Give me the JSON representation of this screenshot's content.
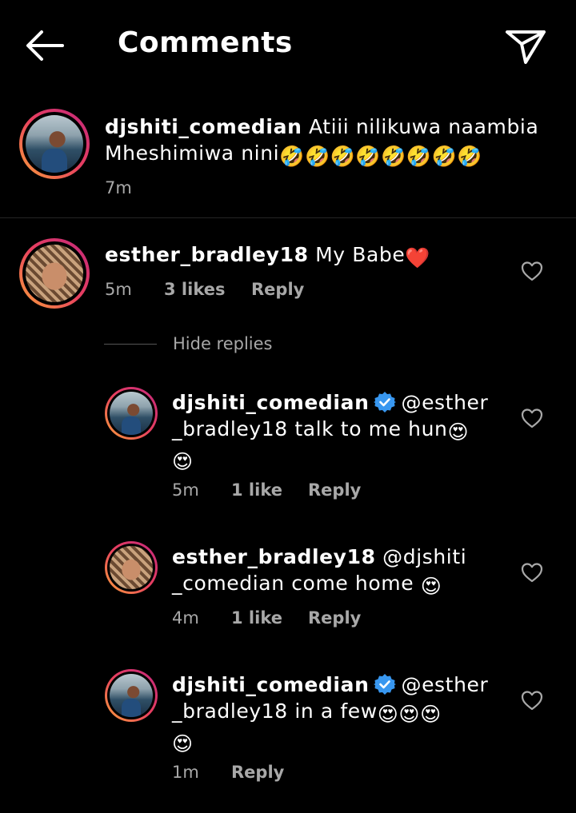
{
  "header": {
    "title": "Comments",
    "back_icon": "arrow-left-icon",
    "send_icon": "paper-plane-icon"
  },
  "caption": {
    "username": "djshiti_comedian",
    "text_line1": "Atiii nilikuwa naambia",
    "text_line2": "Mheshimiwa nini",
    "emojis": "🤣🤣🤣🤣🤣🤣🤣🤣",
    "time": "7m"
  },
  "comment": {
    "username": "esther_bradley18",
    "text": "My Babe",
    "emoji": "❤️",
    "time": "5m",
    "likes": "3 likes",
    "reply": "Reply"
  },
  "hide_replies": "Hide replies",
  "replies": [
    {
      "username": "djshiti_comedian",
      "verified": true,
      "line1_rest": "@esther",
      "line2": "_bradley18 talk to me hun",
      "line2_emoji": "😍",
      "line3_emoji": "😍",
      "time": "5m",
      "likes": "1 like",
      "reply": "Reply"
    },
    {
      "username": "esther_bradley18",
      "verified": false,
      "line1_rest": "@djshiti",
      "line2": "_comedian come home",
      "line2_emoji": "😍",
      "time": "4m",
      "likes": "1 like",
      "reply": "Reply"
    },
    {
      "username": "djshiti_comedian",
      "verified": true,
      "line1_rest": "@esther",
      "line2": "_bradley18 in a few",
      "line2_emoji": "😍😍😍",
      "line3_emoji": "😍",
      "time": "1m",
      "reply": "Reply"
    }
  ],
  "colors": {
    "background": "#000000",
    "text": "#ffffff",
    "meta": "#a8a8a8",
    "verified": "#3897f0",
    "heart_emoji": "#e0245e"
  }
}
